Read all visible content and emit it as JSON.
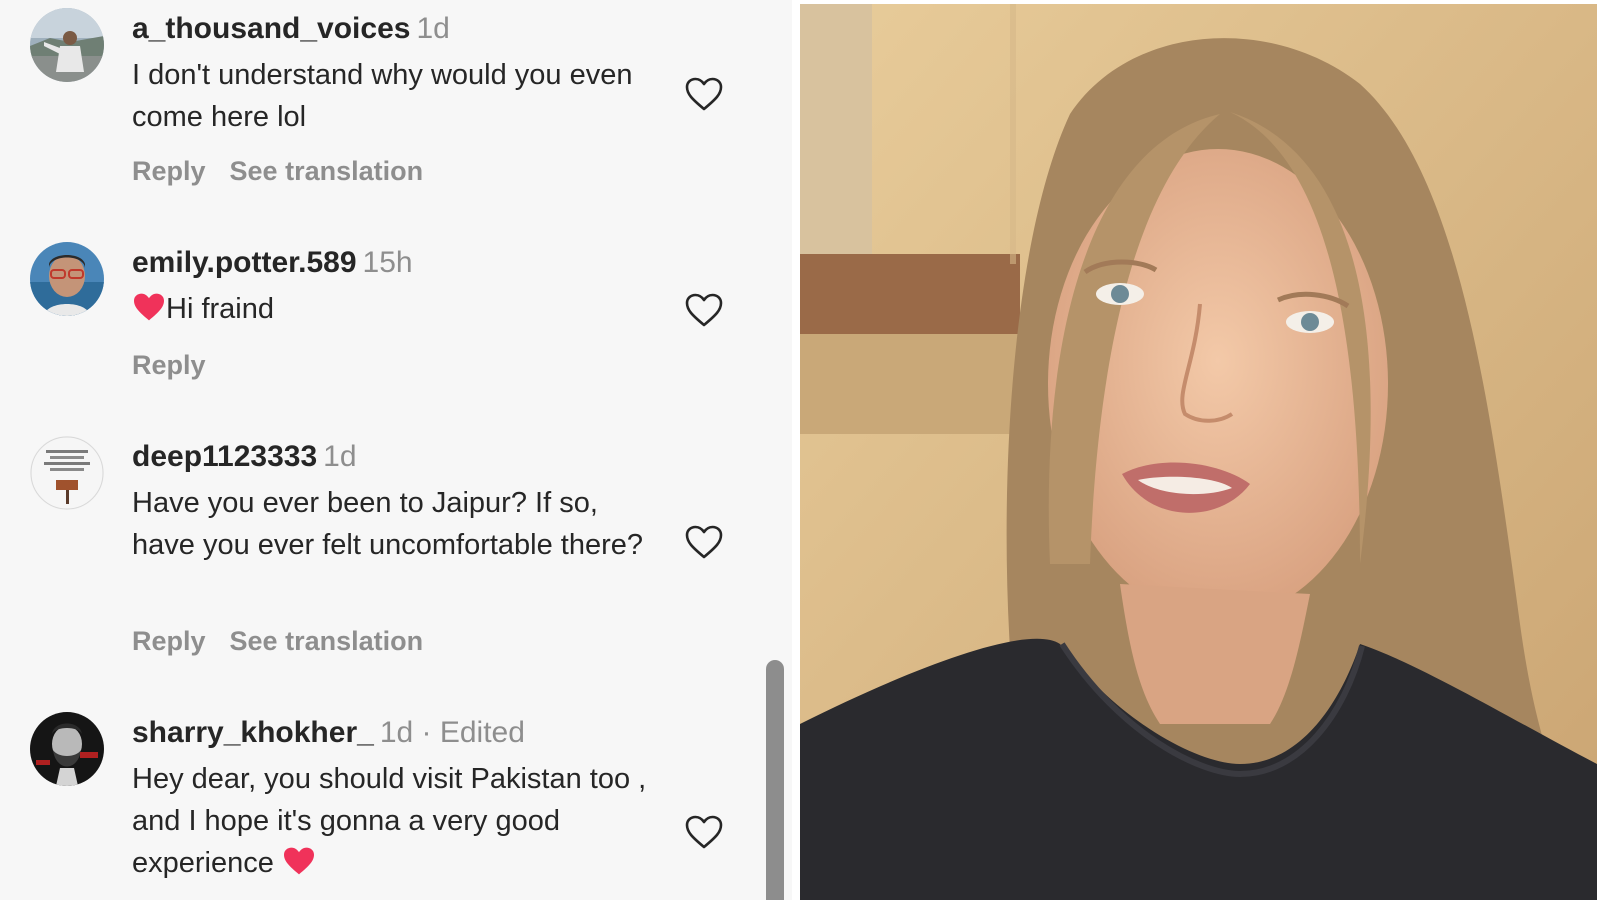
{
  "comments": [
    {
      "username": "a_thousand_voices",
      "time": "1d",
      "edited": "",
      "text": "I don't understand why would you even come here lol",
      "reply_label": "Reply",
      "translation_label": "See translation",
      "avatar_icon": "person-photo-avatar"
    },
    {
      "username": "emily.potter.589",
      "time": "15h",
      "edited": "",
      "text": "Hi fraind",
      "reply_label": "Reply",
      "translation_label": "",
      "avatar_icon": "person-glasses-avatar"
    },
    {
      "username": "deep1123333",
      "time": "1d",
      "edited": "",
      "text": "Have you ever been to Jaipur? If so, have you ever felt uncomfortable there?",
      "reply_label": "Reply",
      "translation_label": "See translation",
      "avatar_icon": "sign-avatar"
    },
    {
      "username": "sharry_khokher_",
      "time": "1d",
      "edited": "· Edited",
      "text": "Hey dear, you should visit Pakistan too , and I hope it's gonna a very good experience",
      "reply_label": "",
      "translation_label": "",
      "avatar_icon": "bearded-man-avatar"
    }
  ],
  "colors": {
    "panel_bg": "#f7f7f7",
    "text": "#262626",
    "muted": "#8e8e8e",
    "heart_emoji": "#f0325a"
  },
  "video": {
    "icon": "video-frame-woman-talking"
  }
}
